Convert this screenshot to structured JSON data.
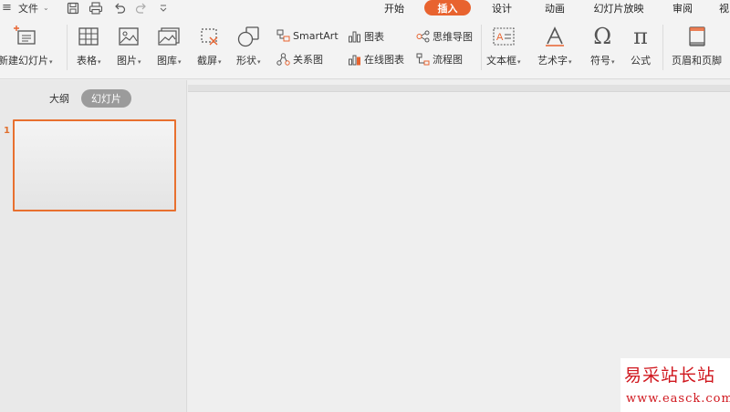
{
  "menubar": {
    "hamburger": "≡",
    "file_label": "文件",
    "tabs": [
      {
        "label": "开始"
      },
      {
        "label": "插入"
      },
      {
        "label": "设计"
      },
      {
        "label": "动画"
      },
      {
        "label": "幻灯片放映"
      },
      {
        "label": "审阅"
      },
      {
        "label": "视"
      }
    ],
    "active_tab": "插入",
    "accent_color": "#e8632f"
  },
  "ribbon": {
    "new_slide": "新建幻灯片",
    "table": "表格",
    "picture": "图片",
    "gallery": "图库",
    "screenshot": "截屏",
    "shape": "形状",
    "smartart": "SmartArt",
    "relation": "关系图",
    "chart": "图表",
    "online_chart": "在线图表",
    "mindmap": "思维导图",
    "flowchart": "流程图",
    "textbox": "文本框",
    "wordart": "艺术字",
    "symbol": "符号",
    "formula": "公式",
    "header_footer": "页眉和页脚"
  },
  "panel": {
    "tabs": [
      {
        "label": "大纲"
      },
      {
        "label": "幻灯片"
      }
    ],
    "active_tab": "幻灯片",
    "slides": [
      {
        "number": "1"
      }
    ]
  },
  "watermark": {
    "title": "易采站长站",
    "url": "www.easck.com"
  }
}
